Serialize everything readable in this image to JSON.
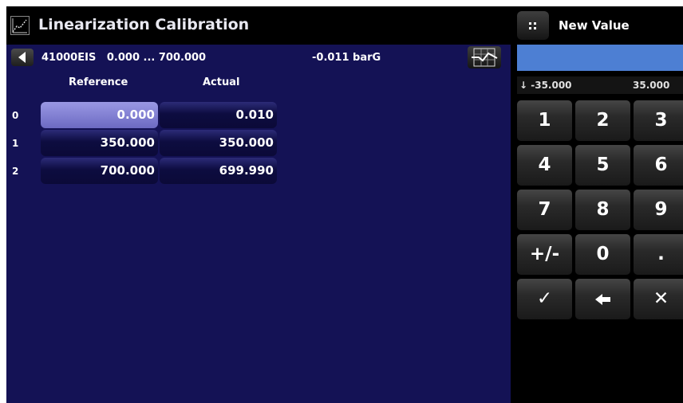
{
  "header": {
    "title": "Linearization Calibration",
    "icon": "linearization-chart-icon"
  },
  "toolbar": {
    "back_icon": "back-arrow-icon",
    "sensor": "41000EIS",
    "range": "0.000 ... 700.000",
    "reading": "-0.011 barG",
    "graph_icon": "graph-icon"
  },
  "table": {
    "col_reference": "Reference",
    "col_actual": "Actual",
    "rows": [
      {
        "index": "0",
        "reference": "0.000",
        "actual": "0.010",
        "selected": true
      },
      {
        "index": "1",
        "reference": "350.000",
        "actual": "350.000",
        "selected": false
      },
      {
        "index": "2",
        "reference": "700.000",
        "actual": "699.990",
        "selected": false
      }
    ]
  },
  "keypad": {
    "title": "New Value",
    "keypad_icon": "keypad-icon",
    "input_value": "",
    "range_min": "↓ -35.000",
    "range_max": "35.000",
    "keys": [
      {
        "label": "1",
        "name": "key-1"
      },
      {
        "label": "2",
        "name": "key-2"
      },
      {
        "label": "3",
        "name": "key-3"
      },
      {
        "label": "4",
        "name": "key-4"
      },
      {
        "label": "5",
        "name": "key-5"
      },
      {
        "label": "6",
        "name": "key-6"
      },
      {
        "label": "7",
        "name": "key-7"
      },
      {
        "label": "8",
        "name": "key-8"
      },
      {
        "label": "9",
        "name": "key-9"
      },
      {
        "label": "+/-",
        "name": "key-plus-minus"
      },
      {
        "label": "0",
        "name": "key-0"
      },
      {
        "label": ".",
        "name": "key-decimal"
      },
      {
        "label": "✓",
        "name": "confirm-icon"
      },
      {
        "label": "🡐",
        "name": "backspace-icon"
      },
      {
        "label": "✕",
        "name": "cancel-icon"
      }
    ]
  },
  "colors": {
    "panel_bg": "#141255",
    "selected_cell": "#8e8cdc",
    "input_field": "#4d7fd3"
  }
}
